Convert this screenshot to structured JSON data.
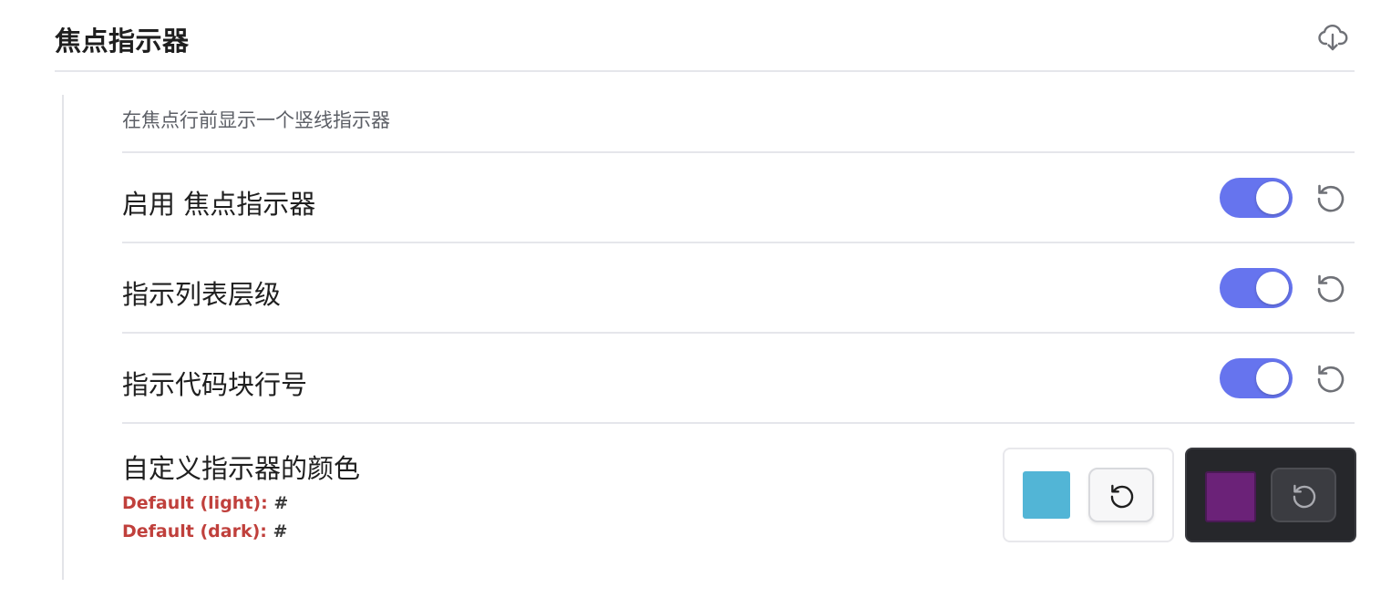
{
  "section": {
    "title": "焦点指示器",
    "description": "在焦点行前显示一个竖线指示器"
  },
  "settings": [
    {
      "label": "启用 焦点指示器",
      "enabled": true
    },
    {
      "label": "指示列表层级",
      "enabled": true
    },
    {
      "label": "指示代码块行号",
      "enabled": true
    }
  ],
  "color_setting": {
    "label": "自定义指示器的颜色",
    "default_light_label": "Default (light):",
    "default_light_value": "#",
    "default_dark_label": "Default (dark):",
    "default_dark_value": "#",
    "light_swatch_color": "#52b5d6",
    "dark_swatch_color": "#6b2278"
  },
  "colors": {
    "accent": "#6674ee",
    "default_label": "#c0403c"
  },
  "icons": {
    "header": "cloud-download-icon",
    "reset": "reset-icon"
  }
}
